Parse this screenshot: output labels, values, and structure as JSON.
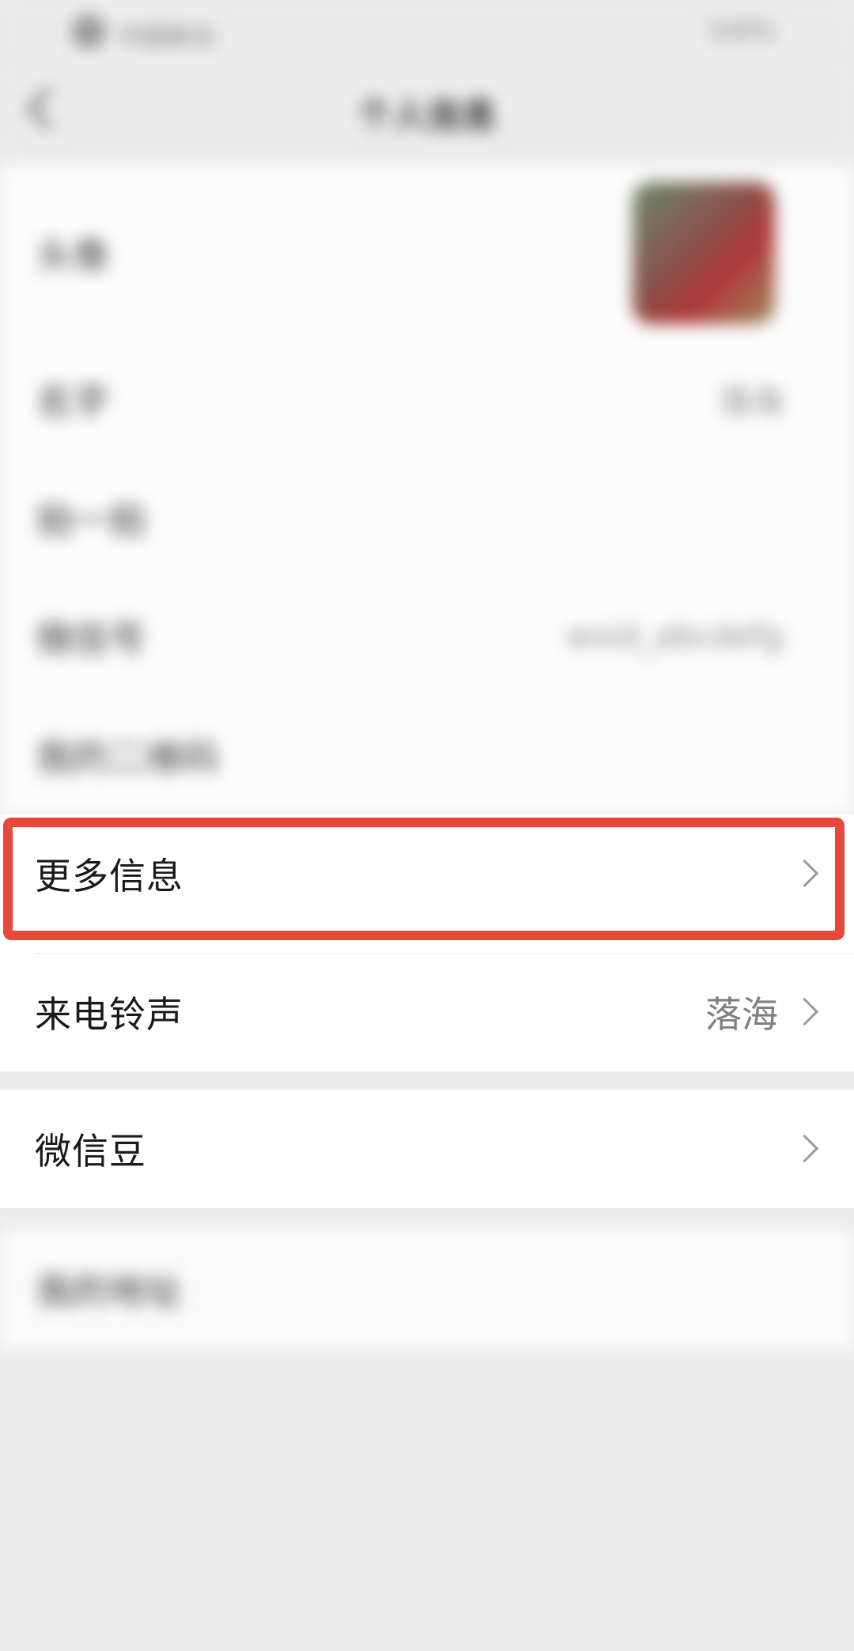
{
  "status_bar": {
    "left_text": "中国移动",
    "right_text": "100%"
  },
  "nav": {
    "title": "个人信息"
  },
  "blurred_rows": [
    {
      "label": "头像",
      "value": ""
    },
    {
      "label": "名字",
      "value": "落海"
    },
    {
      "label": "拍一拍",
      "value": ""
    },
    {
      "label": "微信号",
      "value": "wxid_abcdefg"
    },
    {
      "label": "我的二维码",
      "value": ""
    }
  ],
  "rows": {
    "more_info": {
      "label": "更多信息"
    },
    "ringtone": {
      "label": "来电铃声",
      "value": "落海"
    },
    "wechat_beans": {
      "label": "微信豆"
    }
  },
  "bottom_blurred_row": {
    "label": "我的地址"
  },
  "colors": {
    "highlight_border": "#e8473b",
    "background": "#ededed",
    "row_background": "#ffffff"
  },
  "icons": {
    "chevron": "chevron-right-icon",
    "back": "back-arrow-icon"
  }
}
